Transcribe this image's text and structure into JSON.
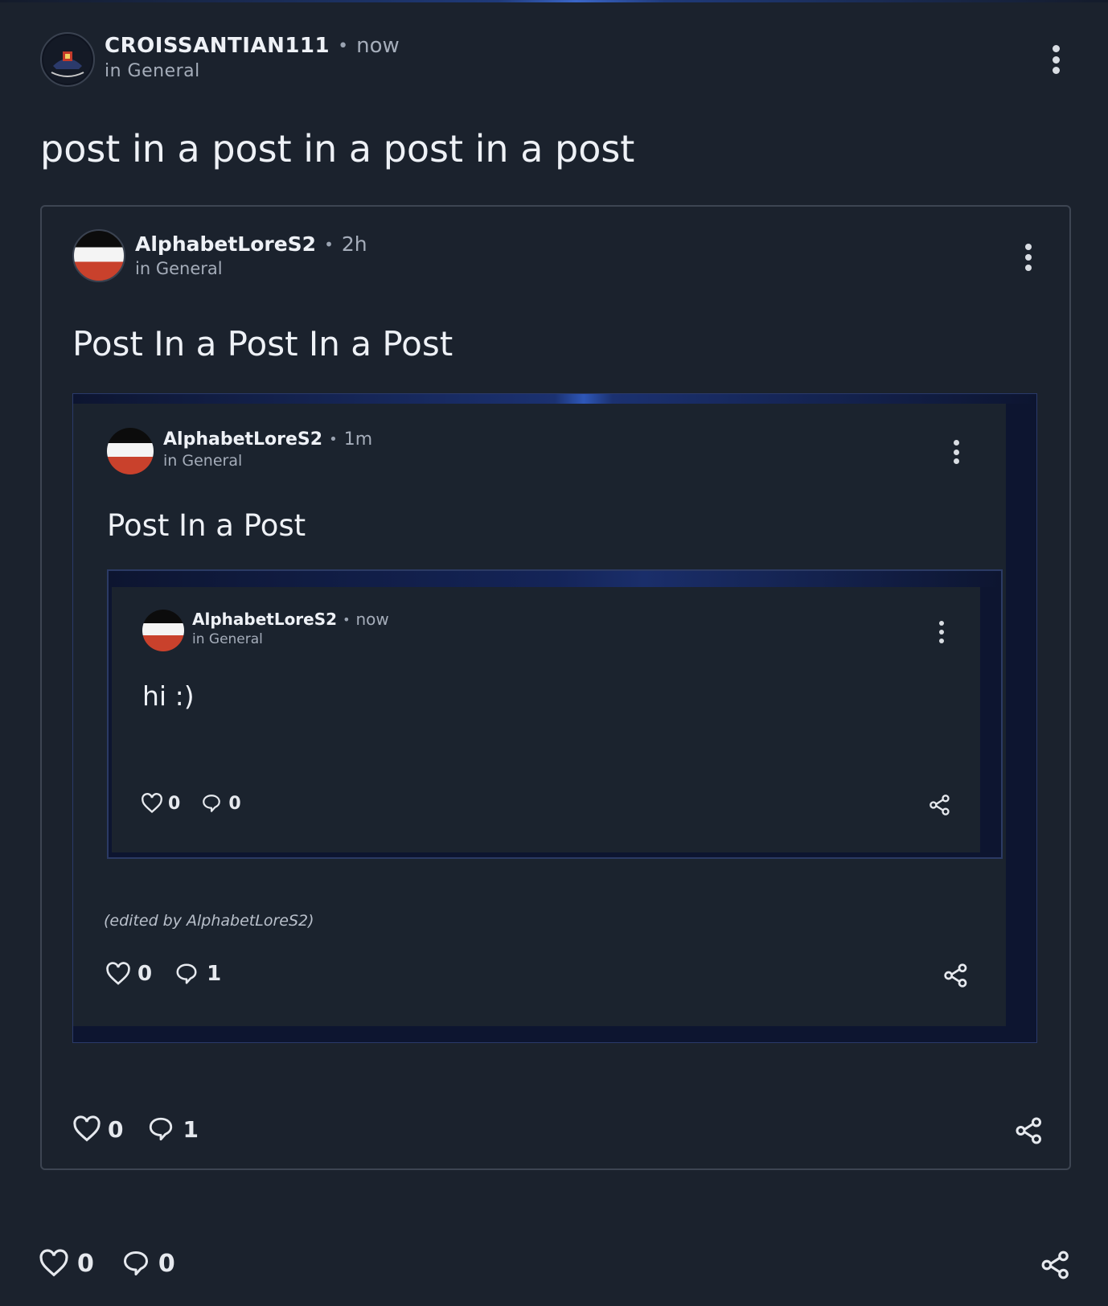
{
  "outer": {
    "author": "CROISSANTIAN111",
    "time": "now",
    "category": "in General",
    "title": "post in a post in a post in a post",
    "likes": "0",
    "comments": "0"
  },
  "level1": {
    "author": "AlphabetLoreS2",
    "time": "2h",
    "category": "in General",
    "title": "Post In a Post In a Post",
    "likes": "0",
    "comments": "1"
  },
  "level2": {
    "author": "AlphabetLoreS2",
    "time": "1m",
    "category": "in General",
    "title": "Post In a Post",
    "edited_note": "(edited by AlphabetLoreS2)",
    "likes": "0",
    "comments": "1"
  },
  "level3": {
    "author": "AlphabetLoreS2",
    "time": "now",
    "category": "in General",
    "title": "hi :)",
    "likes": "0",
    "comments": "0"
  },
  "icons": {
    "like": "heart-icon",
    "comment": "comment-bubble-icon",
    "share": "share-icon",
    "more": "kebab-menu-icon"
  },
  "colors": {
    "background": "#1b222d",
    "flag_top": "#0c0c0c",
    "flag_middle": "#f4f4f4",
    "flag_bottom": "#c9412c"
  }
}
